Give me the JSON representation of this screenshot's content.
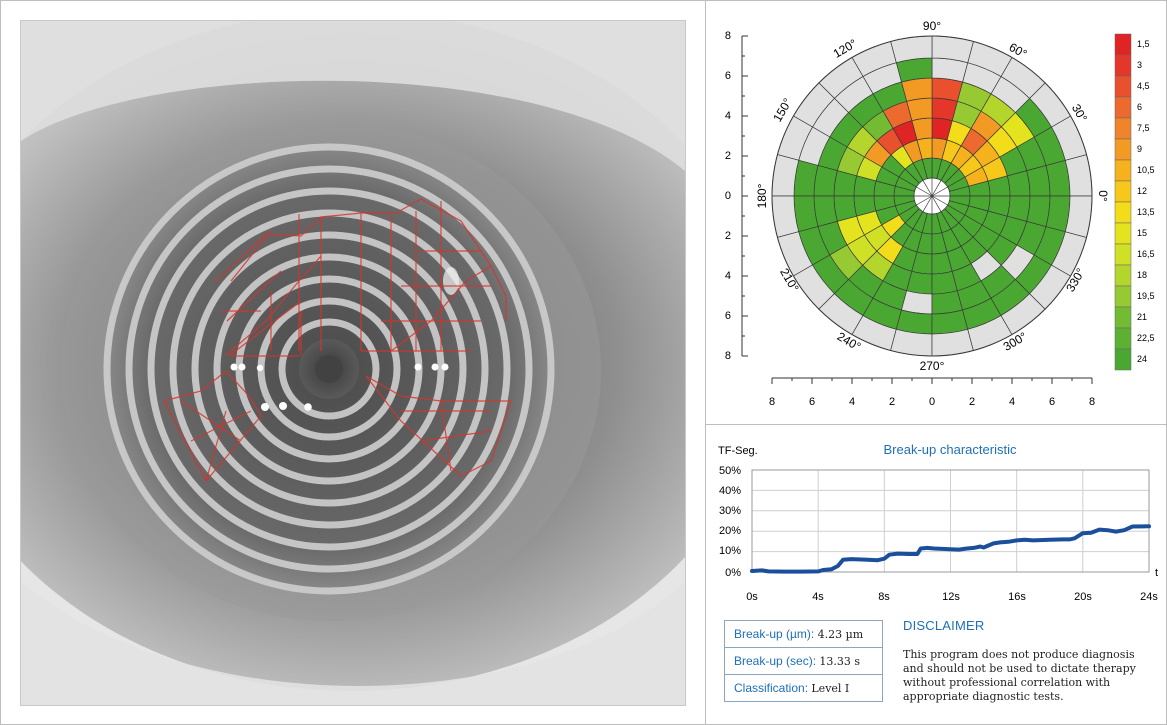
{
  "polar_map": {
    "angle_labels": [
      "90°",
      "60°",
      "30°",
      "0°",
      "330°",
      "300°",
      "270°",
      "240°",
      "210°",
      "180°",
      "150°",
      "120°"
    ],
    "y_axis_labels": [
      "8",
      "6",
      "4",
      "2",
      "0",
      "2",
      "4",
      "6",
      "8"
    ],
    "x_axis_labels": [
      "8",
      "6",
      "4",
      "2",
      "0",
      "2",
      "4",
      "6",
      "8"
    ],
    "scale": [
      {
        "label": "1,5",
        "color": "#e02424"
      },
      {
        "label": "3",
        "color": "#e4372a"
      },
      {
        "label": "4,5",
        "color": "#e8502e"
      },
      {
        "label": "6",
        "color": "#ec6a2e"
      },
      {
        "label": "7,5",
        "color": "#f0842c"
      },
      {
        "label": "9",
        "color": "#f39a24"
      },
      {
        "label": "10,5",
        "color": "#f6b21c"
      },
      {
        "label": "12",
        "color": "#f6c81a"
      },
      {
        "label": "13,5",
        "color": "#f3dc1a"
      },
      {
        "label": "15",
        "color": "#e3e31e"
      },
      {
        "label": "16,5",
        "color": "#cfe026"
      },
      {
        "label": "18",
        "color": "#b4d52c"
      },
      {
        "label": "19,5",
        "color": "#96c932"
      },
      {
        "label": "21",
        "color": "#74bb34"
      },
      {
        "label": "22,5",
        "color": "#5cb133"
      },
      {
        "label": "24",
        "color": "#4aa832"
      }
    ]
  },
  "breakup_chart": {
    "title": "Break-up characteristic",
    "y_label": "TF-Seg.",
    "x_label": "t",
    "y_ticks": [
      "50%",
      "40%",
      "30%",
      "20%",
      "10%",
      "0%"
    ],
    "x_ticks": [
      "0s",
      "4s",
      "8s",
      "12s",
      "16s",
      "20s",
      "24s"
    ],
    "line_color": "#1b4f9c"
  },
  "chart_data": {
    "type": "line",
    "title": "Break-up characteristic",
    "xlabel": "t",
    "ylabel": "TF-Seg.",
    "xlim": [
      0,
      24
    ],
    "ylim": [
      0,
      50
    ],
    "x": [
      0,
      0.6,
      1,
      2,
      3,
      4,
      4.3,
      4.8,
      5.2,
      5.5,
      6,
      7,
      7.6,
      8,
      8.3,
      8.8,
      9.5,
      10,
      10.2,
      10.6,
      11,
      12,
      12.5,
      13,
      13.4,
      13.8,
      14,
      14.6,
      15,
      15.5,
      16,
      16.5,
      17,
      18,
      18.8,
      19.2,
      19.5,
      20,
      20.5,
      21,
      21.5,
      22,
      22.5,
      23,
      24
    ],
    "y": [
      0.5,
      0.8,
      0.3,
      0.2,
      0.2,
      0.3,
      1.0,
      1.3,
      3.0,
      6.0,
      6.3,
      6.0,
      5.8,
      6.5,
      8.5,
      9.0,
      8.8,
      8.8,
      11.5,
      11.8,
      11.5,
      11.2,
      11.0,
      11.5,
      11.8,
      12.5,
      12.0,
      14.0,
      14.5,
      14.8,
      15.5,
      15.8,
      15.5,
      15.8,
      16.0,
      16.0,
      16.5,
      19.0,
      19.2,
      20.8,
      20.5,
      19.8,
      20.5,
      22.3,
      22.4
    ]
  },
  "results": {
    "rows": [
      {
        "label": "Break-up (µm):",
        "value": "4.23 µm"
      },
      {
        "label": "Break-up (sec):",
        "value": "13.33 s"
      },
      {
        "label": "Classification:",
        "value": "Level I"
      }
    ]
  },
  "disclaimer": {
    "title": "DISCLAIMER",
    "text": "This program does not produce diagnosis and should not be used to dictate therapy without professional correlation with appropriate diagnostic tests."
  }
}
